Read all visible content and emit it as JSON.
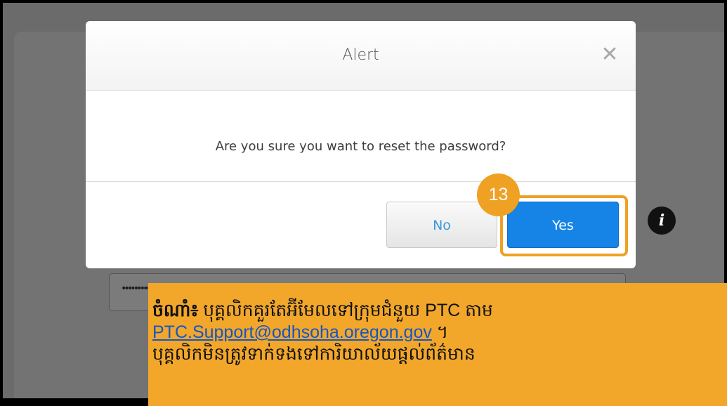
{
  "dialog": {
    "title": "Alert",
    "close_symbol": "✕",
    "message": "Are you sure you want to reset the password?",
    "no_label": "No",
    "yes_label": "Yes"
  },
  "background": {
    "password_mask": "••••••••••••••••"
  },
  "annotation": {
    "step_number": "13",
    "note_label": "ចំណាំ៖",
    "note_line1": " បុគ្គលិកគួរតែអ៊ីមែលទៅក្រុមជំនួយ PTC តាម",
    "note_email": "PTC.Support@odhsoha.oregon.gov",
    "note_line2_suffix": " ។",
    "note_line3": "បុគ្គលិកមិនត្រូវទាក់ទងទៅការិយាល័យផ្តល់ព័ត៌មាន"
  },
  "icons": {
    "info": "info-icon",
    "close": "close-icon"
  },
  "colors": {
    "primary_button": "#1584e6",
    "annotation_orange": "#efa124",
    "link_blue": "#1456c6"
  }
}
